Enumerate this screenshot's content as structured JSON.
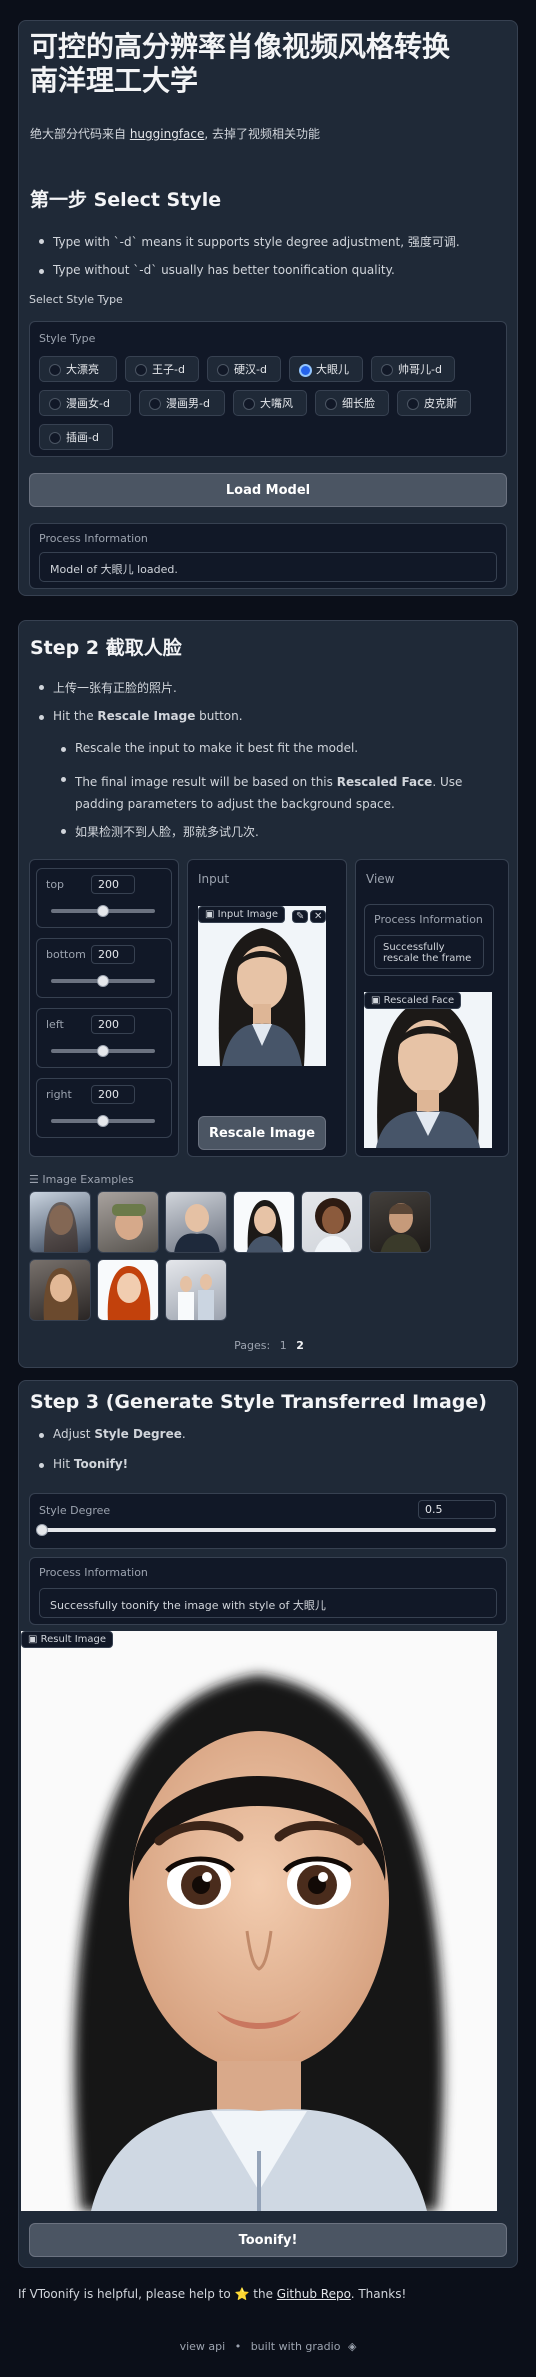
{
  "header": {
    "title_line1": "可控的高分辨率肖像视频风格转换",
    "title_line2": "南洋理工大学",
    "desc_prefix": "绝大部分代码来自 ",
    "desc_link": "huggingface",
    "desc_suffix": ", 去掉了视频相关功能"
  },
  "step1": {
    "title": "第一步 Select Style",
    "bullets": [
      "Type with `-d` means it supports style degree adjustment, 强度可调.",
      "Type without `-d` usually has better toonification quality."
    ],
    "select_label": "Select Style Type",
    "style_type_label": "Style Type",
    "styles": [
      "大漂亮",
      "王子-d",
      "硬汉-d",
      "大眼儿",
      "帅哥儿-d",
      "漫画女-d",
      "漫画男-d",
      "大嘴风",
      "细长脸",
      "皮克斯",
      "插画-d"
    ],
    "selected_style": "大眼儿",
    "load_button": "Load Model",
    "process_label": "Process Information",
    "process_text": "Model of 大眼儿 loaded."
  },
  "step2": {
    "title": "Step 2 截取人脸",
    "bullet1": "上传一张有正脸的照片.",
    "bullet2_prefix": "Hit the ",
    "bullet2_bold": "Rescale Image",
    "bullet2_suffix": " button.",
    "sub1": "Rescale the input to make it best fit the model.",
    "sub2_prefix": "The final image result will be based on this ",
    "sub2_bold": "Rescaled Face",
    "sub2_suffix": ". Use padding parameters to adjust the background space.",
    "sub3": "如果检测不到人脸，那就多试几次.",
    "sliders": [
      {
        "label": "top",
        "value": "200",
        "fraction": 0.5
      },
      {
        "label": "bottom",
        "value": "200",
        "fraction": 0.5
      },
      {
        "label": "left",
        "value": "200",
        "fraction": 0.5
      },
      {
        "label": "right",
        "value": "200",
        "fraction": 0.5
      }
    ],
    "input_label": "Input",
    "input_image_label": "Input Image",
    "rescale_button": "Rescale Image",
    "view_label": "View",
    "view_process_label": "Process Information",
    "view_process_text": "Successfully rescale the frame",
    "rescaled_face_label": "Rescaled Face",
    "examples_label": "Image Examples",
    "pages_label": "Pages:",
    "pages": [
      "1",
      "2"
    ],
    "current_page": "2"
  },
  "step3": {
    "title": "Step 3 (Generate Style Transferred Image)",
    "bullet1_prefix": "Adjust ",
    "bullet1_bold": "Style Degree",
    "bullet1_suffix": ".",
    "bullet2_prefix": "Hit ",
    "bullet2_bold": "Toonify!",
    "degree_label": "Style Degree",
    "degree_value": "0.5",
    "degree_fraction": 0.0,
    "process_label": "Process Information",
    "process_text": "Successfully toonify the image with style of 大眼儿",
    "result_label": "Result Image",
    "toonify_button": "Toonify!"
  },
  "footer": {
    "text_prefix": "If VToonify is helpful, please help to ",
    "star": "⭐",
    "text_mid": " the ",
    "link": "Github Repo",
    "text_suffix": ". Thanks!",
    "view_api": "view api",
    "dot": "•",
    "built_with": "built with gradio"
  },
  "colors": {
    "background": "#0b0f19",
    "panel": "#1f2937",
    "accent": "#2563eb"
  }
}
